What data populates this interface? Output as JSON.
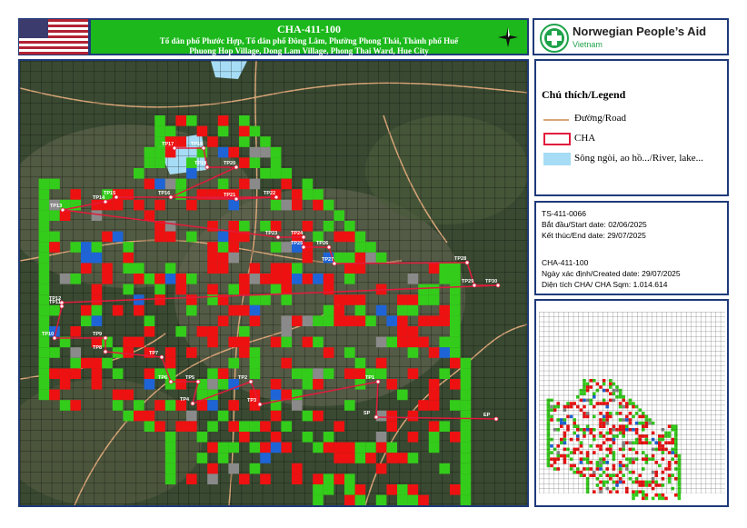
{
  "header": {
    "title": "CHA-411-100",
    "subtitle_vi": "Tổ dân phố Phước Hợp, Tổ dân phố Đông Lâm,  Phường Phong Thái, Thành phố Huế",
    "subtitle_en": "Phuong Hop Village, Dong Lam Village, Phong Thai Ward, Hue City"
  },
  "org": {
    "name": "Norwegian People’s Aid",
    "country": "Vietnam"
  },
  "legend": {
    "title": "Chú thích/Legend",
    "road": "Đường/Road",
    "cha": "CHA",
    "water": "Sông ngòi, ao hồ.../River, lake..."
  },
  "info": {
    "ts_id": "TS-411-0066",
    "start": "Bắt đầu/Start date: 02/06/2025",
    "end": "Kết thúc/End date: 29/07/2025",
    "cha_id": "CHA-411-100",
    "created": "Ngày xác định/Created date: 29/07/2025",
    "area": "Diện tích CHA/ CHA Sqm: 1.014.614"
  },
  "colors": {
    "green": "#33cc1a",
    "red": "#ee1111",
    "blue": "#1e64d6",
    "grey": "#8a8a8a",
    "road": "#d9a679",
    "cha_line": "#e21b3c",
    "water": "#a6dcf5"
  },
  "points": [
    {
      "label": "TP17"
    },
    {
      "label": "TP18"
    },
    {
      "label": "TP19"
    },
    {
      "label": "TP20"
    },
    {
      "label": "TP16"
    },
    {
      "label": "TP21"
    },
    {
      "label": "TP22"
    },
    {
      "label": "TP15"
    },
    {
      "label": "TP14"
    },
    {
      "label": "TP13"
    },
    {
      "label": "TP23"
    },
    {
      "label": "TP24"
    },
    {
      "label": "TP25"
    },
    {
      "label": "TP26"
    },
    {
      "label": "TP27"
    },
    {
      "label": "TP28"
    },
    {
      "label": "TP29"
    },
    {
      "label": "TP30"
    },
    {
      "label": "TP12"
    },
    {
      "label": "TP11"
    },
    {
      "label": "TP10"
    },
    {
      "label": "TP9"
    },
    {
      "label": "TP8"
    },
    {
      "label": "TP7"
    },
    {
      "label": "TP6"
    },
    {
      "label": "TP5"
    },
    {
      "label": "TP4"
    },
    {
      "label": "TP2"
    },
    {
      "label": "TP3"
    },
    {
      "label": "TP1"
    },
    {
      "label": "SP"
    },
    {
      "label": "EP"
    }
  ]
}
